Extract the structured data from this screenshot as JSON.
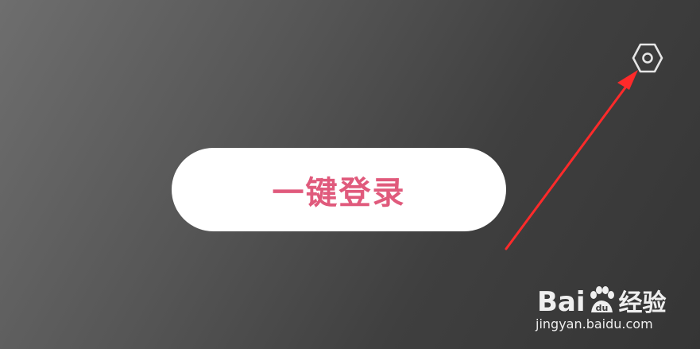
{
  "login_button": {
    "label": "一键登录",
    "label_color": "#e05a7c",
    "background": "#ffffff"
  },
  "settings": {
    "icon": "settings-hexagon-icon",
    "color": "#e6e6e6"
  },
  "annotation": {
    "type": "arrow",
    "color": "#ff2a2a"
  },
  "watermark": {
    "brand_prefix": "Bai",
    "brand_mark": "du",
    "brand_suffix": "经验",
    "url": "jingyan.baidu.com"
  }
}
